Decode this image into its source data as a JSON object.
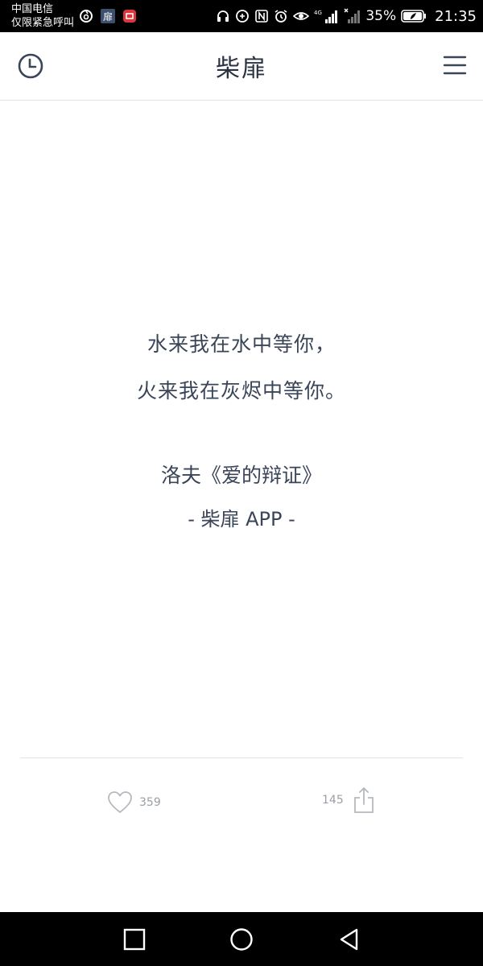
{
  "status_bar": {
    "carrier_line1": "中国电信",
    "carrier_line2": "仅限紧急呼叫",
    "notification_app_label": "扉",
    "battery_percent": "35%",
    "time": "21:35"
  },
  "header": {
    "title": "柴扉"
  },
  "quote": {
    "line1": "水来我在水中等你，",
    "line2": "火来我在灰烬中等你。",
    "source": "洛夫《爱的辩证》",
    "app_tag": "- 柴扉 APP -"
  },
  "actions": {
    "like_count": "359",
    "share_count": "145"
  },
  "colors": {
    "text": "#3a4558",
    "count_text": "#9a9fa6",
    "divider": "#e2e2e2",
    "system_bars": "#000000"
  }
}
